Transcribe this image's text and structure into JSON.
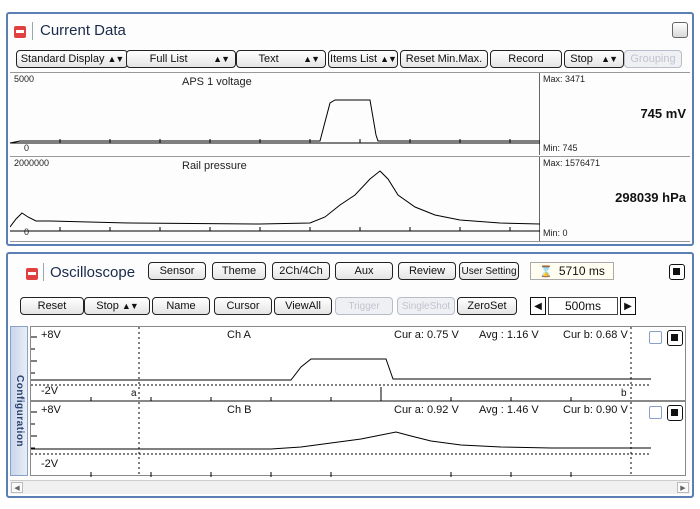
{
  "current_data": {
    "title": "Current Data",
    "toolbar": {
      "standard_display": "Standard Display",
      "full_list": "Full List",
      "text": "Text",
      "items_list": "Items List",
      "reset_minmax": "Reset Min.Max.",
      "record": "Record",
      "stop": "Stop",
      "grouping": "Grouping"
    },
    "channels": [
      {
        "name": "APS 1 voltage",
        "scale_top": "5000",
        "scale_bottom": "0",
        "max": "Max: 3471",
        "min": "Min: 745",
        "value": "745 mV"
      },
      {
        "name": "Rail pressure",
        "scale_top": "2000000",
        "scale_bottom": "0",
        "max": "Max: 1576471",
        "min": "Min: 0",
        "value": "298039 hPa"
      }
    ]
  },
  "oscilloscope": {
    "title": "Oscilloscope",
    "top_buttons": {
      "sensor": "Sensor",
      "theme": "Theme",
      "ch_mode": "2Ch/4Ch",
      "aux": "Aux",
      "review": "Review",
      "user_setting": "User Setting"
    },
    "elapsed": "5710 ms",
    "buttons": {
      "reset": "Reset",
      "stop": "Stop",
      "name": "Name",
      "cursor": "Cursor",
      "view_all": "ViewAll",
      "trigger": "Trigger",
      "single_shot": "SingleShot",
      "zero_set": "ZeroSet"
    },
    "timebase": "500ms",
    "config_tab": "Configuration",
    "channels": [
      {
        "name": "Ch A",
        "top": "+8V",
        "bottom": "-2V",
        "cursor_a_label": "a",
        "cursor_b_label": "b",
        "cur_a": "Cur a: 0.75 V",
        "avg": "Avg  : 1.16 V",
        "cur_b": "Cur b: 0.68 V"
      },
      {
        "name": "Ch B",
        "top": "+8V",
        "bottom": "-2V",
        "cur_a": "Cur a: 0.92 V",
        "avg": "Avg  : 1.46 V",
        "cur_b": "Cur b: 0.90 V"
      }
    ]
  },
  "colors": {
    "panel_border": "#5b7fb2",
    "collapse": "#e04040",
    "disabled_text": "#c0c4ce",
    "config_tab_text": "#2a4270"
  }
}
